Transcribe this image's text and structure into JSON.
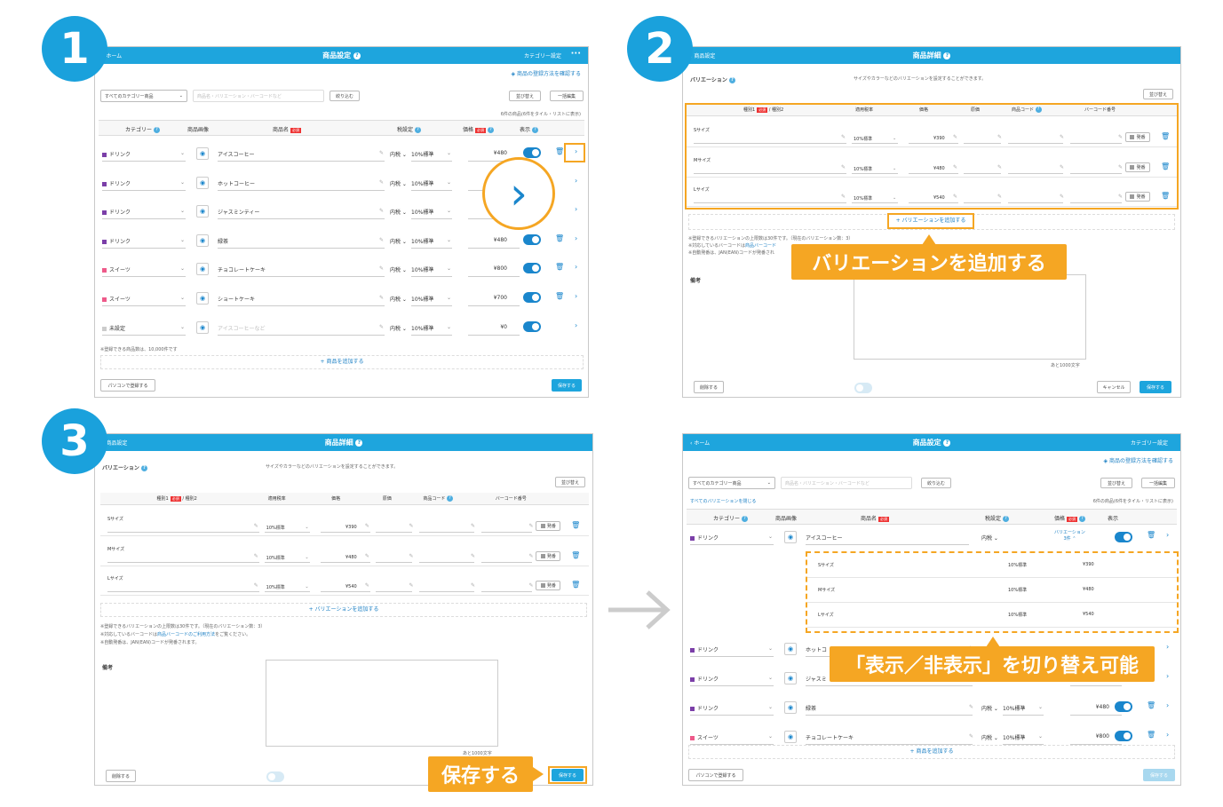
{
  "badges": [
    "1",
    "2",
    "3"
  ],
  "arrow": "→",
  "s1": {
    "header": {
      "back": "ホーム",
      "title": "商品設定",
      "right": "カテゴリー設定"
    },
    "help_link": "商品の登録方法を確認する",
    "category_select": "すべてのカテゴリー商品",
    "search_placeholder": "商品名・バリエーション・バーコードなど",
    "filter_btn": "絞り込む",
    "sort_btn": "並び替え",
    "bulk_btn": "一括編集",
    "count_note": "6件の商品(6件をタイル・リストに表示)",
    "columns": {
      "category": "カテゴリー",
      "image": "商品画像",
      "name": "商品名",
      "required": "必須",
      "tax": "税設定",
      "price": "価格",
      "display": "表示"
    },
    "rows": [
      {
        "cat": "ドリンク",
        "name": "アイスコーヒー",
        "tax_type": "内税",
        "tax_rate": "10%標準",
        "price": "¥480",
        "color": "#7b3fa8"
      },
      {
        "cat": "ドリンク",
        "name": "ホットコーヒー",
        "tax_type": "内税",
        "tax_rate": "10%標準",
        "price": "",
        "color": "#7b3fa8"
      },
      {
        "cat": "ドリンク",
        "name": "ジャスミンティー",
        "tax_type": "内税",
        "tax_rate": "10%標準",
        "price": "",
        "color": "#7b3fa8"
      },
      {
        "cat": "ドリンク",
        "name": "緑茶",
        "tax_type": "内税",
        "tax_rate": "10%標準",
        "price": "¥480",
        "color": "#7b3fa8"
      },
      {
        "cat": "スイーツ",
        "name": "チョコレートケーキ",
        "tax_type": "内税",
        "tax_rate": "10%標準",
        "price": "¥800",
        "color": "#ee5a8a"
      },
      {
        "cat": "スイーツ",
        "name": "ショートケーキ",
        "tax_type": "内税",
        "tax_rate": "10%標準",
        "price": "¥700",
        "color": "#ee5a8a"
      },
      {
        "cat": "未設定",
        "name": "アイスコーヒーなど",
        "tax_type": "内税",
        "tax_rate": "10%標準",
        "price": "¥0",
        "color": "#ccc"
      }
    ],
    "limit_note": "※登録できる商品数は、10,000件です",
    "add_product": "+ 商品を追加する",
    "pc_btn": "パソコンで登録する",
    "save_btn": "保存する"
  },
  "s2": {
    "header": {
      "back": "商品設定",
      "title": "商品詳細"
    },
    "variation_label": "バリエーション",
    "variation_desc": "サイズやカラーなどのバリエーションを設定することができます。",
    "sort_btn": "並び替え",
    "columns": {
      "type": "種別1",
      "required": "必須",
      "type2": "/ 種別2",
      "tax": "適用税率",
      "price": "価格",
      "cost": "原価",
      "code": "商品コード",
      "barcode": "バーコード番号"
    },
    "rows": [
      {
        "name": "Sサイズ",
        "tax": "10%標準",
        "price": "¥390",
        "issue": "発番"
      },
      {
        "name": "Mサイズ",
        "tax": "10%標準",
        "price": "¥480",
        "issue": "発番"
      },
      {
        "name": "Lサイズ",
        "tax": "10%標準",
        "price": "¥540",
        "issue": "発番"
      }
    ],
    "add_variation": "+ バリエーションを追加する",
    "notes": [
      "※登録できるバリエーションの上限数は30件です。（現在のバリエーション数：3）",
      "※対応しているバーコードは",
      "※自動発番は、JAN(EAN)コードが発番され"
    ],
    "notes_link": "商品バーコード",
    "callout": "バリエーションを追加する",
    "memo_label": "備考",
    "memo_count": "あと1000文字",
    "delete_btn": "削除する",
    "cancel_btn": "キャンセル",
    "save_btn": "保存する"
  },
  "s3": {
    "header": {
      "back": "商品設定",
      "title": "商品詳細"
    },
    "variation_label": "バリエーション",
    "variation_desc": "サイズやカラーなどのバリエーションを設定することができます。",
    "sort_btn": "並び替え",
    "columns": {
      "type": "種別1",
      "required": "必須",
      "type2": "/ 種別2",
      "tax": "適用税率",
      "price": "価格",
      "cost": "原価",
      "code": "商品コード",
      "barcode": "バーコード番号"
    },
    "rows": [
      {
        "name": "Sサイズ",
        "tax": "10%標準",
        "price": "¥390",
        "issue": "発番"
      },
      {
        "name": "Mサイズ",
        "tax": "10%標準",
        "price": "¥480",
        "issue": "発番"
      },
      {
        "name": "Lサイズ",
        "tax": "10%標準",
        "price": "¥540",
        "issue": "発番"
      }
    ],
    "add_variation": "+ バリエーションを追加する",
    "notes": [
      "※登録できるバリエーションの上限数は30件です。（現在のバリエーション数：3）",
      "※対応しているバーコードは",
      "をご覧ください。",
      "※自動発番は、JAN(EAN)コードが発番されます。"
    ],
    "notes_link": "商品バーコードのご利用方法",
    "memo_label": "備考",
    "memo_count": "あと1000文字",
    "delete_btn": "削除する",
    "save_btn": "保存する",
    "callout": "保存する"
  },
  "s4": {
    "header": {
      "back": "ホーム",
      "title": "商品設定",
      "right": "カテゴリー設定"
    },
    "help_link": "商品の登録方法を確認する",
    "category_select": "すべてのカテゴリー商品",
    "search_placeholder": "商品名・バリエーション・バーコードなど",
    "filter_btn": "絞り込む",
    "sort_btn": "並び替え",
    "bulk_btn": "一括編集",
    "collapse_link": "すべてのバリエーションを閉じる",
    "count_note": "6件の商品(6件をタイル・リストに表示)",
    "columns": {
      "category": "カテゴリー",
      "image": "商品画像",
      "name": "商品名",
      "required": "必須",
      "tax": "税設定",
      "price": "価格",
      "display": "表示"
    },
    "first": {
      "cat": "ドリンク",
      "name": "アイスコーヒー",
      "tax_type": "内税",
      "var_label": "バリエーション",
      "var_count": "3件"
    },
    "variations": [
      {
        "name": "Sサイズ",
        "tax": "10%標準",
        "price": "¥390"
      },
      {
        "name": "Mサイズ",
        "tax": "10%標準",
        "price": "¥480"
      },
      {
        "name": "Lサイズ",
        "tax": "10%標準",
        "price": "¥540"
      }
    ],
    "rows": [
      {
        "cat": "ドリンク",
        "name": "ホットコ",
        "tax_type": "",
        "tax_rate": "",
        "price": "",
        "color": "#7b3fa8"
      },
      {
        "cat": "ドリンク",
        "name": "ジャスミ",
        "tax_type": "",
        "tax_rate": "",
        "price": "",
        "color": "#7b3fa8"
      },
      {
        "cat": "ドリンク",
        "name": "緑茶",
        "tax_type": "内税",
        "tax_rate": "10%標準",
        "price": "¥480",
        "color": "#7b3fa8"
      },
      {
        "cat": "スイーツ",
        "name": "チョコレートケーキ",
        "tax_type": "内税",
        "tax_rate": "10%標準",
        "price": "¥800",
        "color": "#ee5a8a"
      }
    ],
    "callout": "「表示／非表示」を切り替え可能",
    "add_product": "+ 商品を追加する",
    "pc_btn": "パソコンで登録する",
    "save_btn": "保存する"
  }
}
